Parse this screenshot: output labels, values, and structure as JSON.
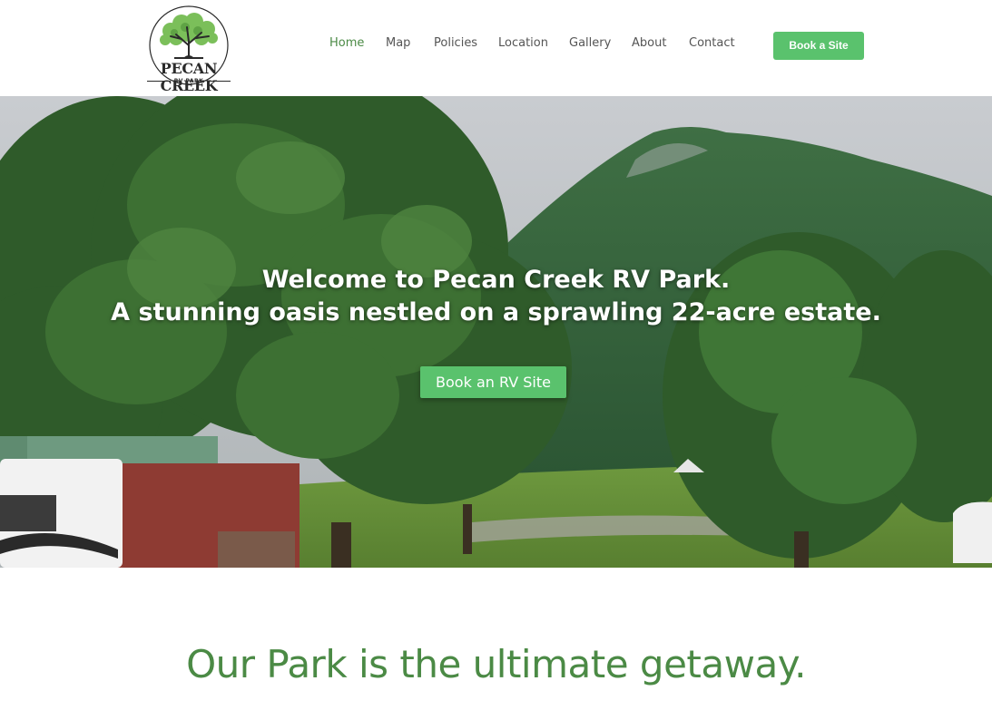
{
  "header": {
    "logo": {
      "name": "PECAN CREEK",
      "subtitle": "RV PARK",
      "icon": "tree-icon"
    },
    "nav": [
      {
        "label": "Home",
        "active": true
      },
      {
        "label": "Map",
        "active": false
      },
      {
        "label": "Policies",
        "active": false
      },
      {
        "label": "Location",
        "active": false
      },
      {
        "label": "Gallery",
        "active": false
      },
      {
        "label": "About",
        "active": false
      },
      {
        "label": "Contact",
        "active": false
      }
    ],
    "cta_label": "Book a Site"
  },
  "hero": {
    "title_line1": "Welcome to Pecan Creek RV Park.",
    "title_line2": "A stunning oasis nestled on a sprawling 22-acre estate.",
    "button_label": "Book an RV Site"
  },
  "section": {
    "heading": "Our Park is the ultimate getaway."
  },
  "colors": {
    "accent_green": "#5ac26d",
    "heading_green": "#4b8a45",
    "nav_text": "#555555"
  }
}
